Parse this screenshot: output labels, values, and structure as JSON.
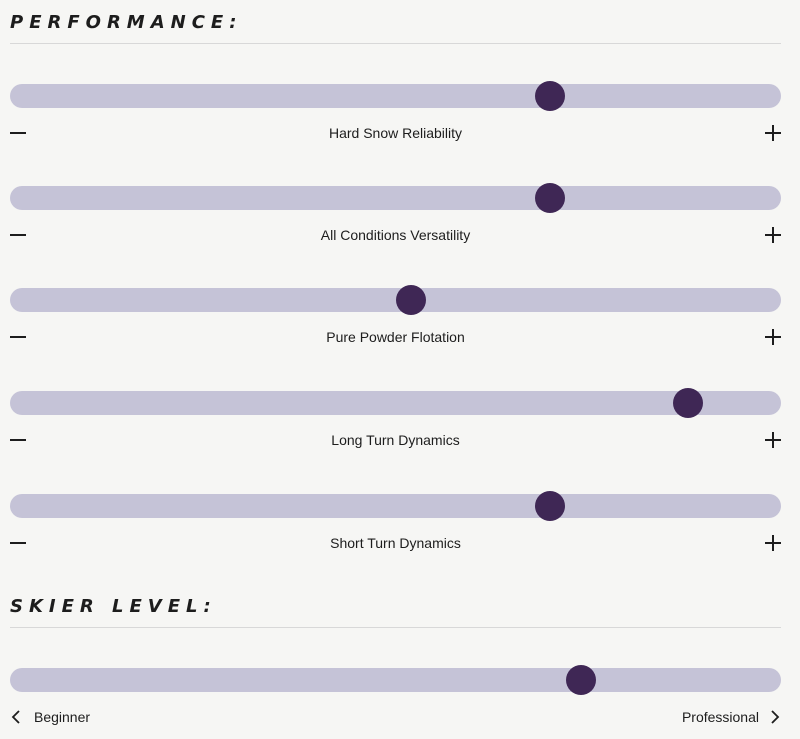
{
  "performance": {
    "title": "PERFORMANCE:",
    "sliders": [
      {
        "label": "Hard Snow Reliability",
        "value": 0.7
      },
      {
        "label": "All Conditions Versatility",
        "value": 0.7
      },
      {
        "label": "Pure Powder Flotation",
        "value": 0.52
      },
      {
        "label": "Long Turn Dynamics",
        "value": 0.88
      },
      {
        "label": "Short Turn Dynamics",
        "value": 0.7
      }
    ],
    "minus_icon": "minus-icon",
    "plus_icon": "plus-icon"
  },
  "skier_level": {
    "title": "SKIER LEVEL:",
    "value": 0.74,
    "min_label": "Beginner",
    "max_label": "Professional",
    "min_icon": "chevron-left-icon",
    "max_icon": "chevron-right-icon"
  },
  "colors": {
    "background": "#f6f6f4",
    "track": "#c5c3d7",
    "thumb": "#3f2755",
    "text": "#1d1d1d"
  }
}
